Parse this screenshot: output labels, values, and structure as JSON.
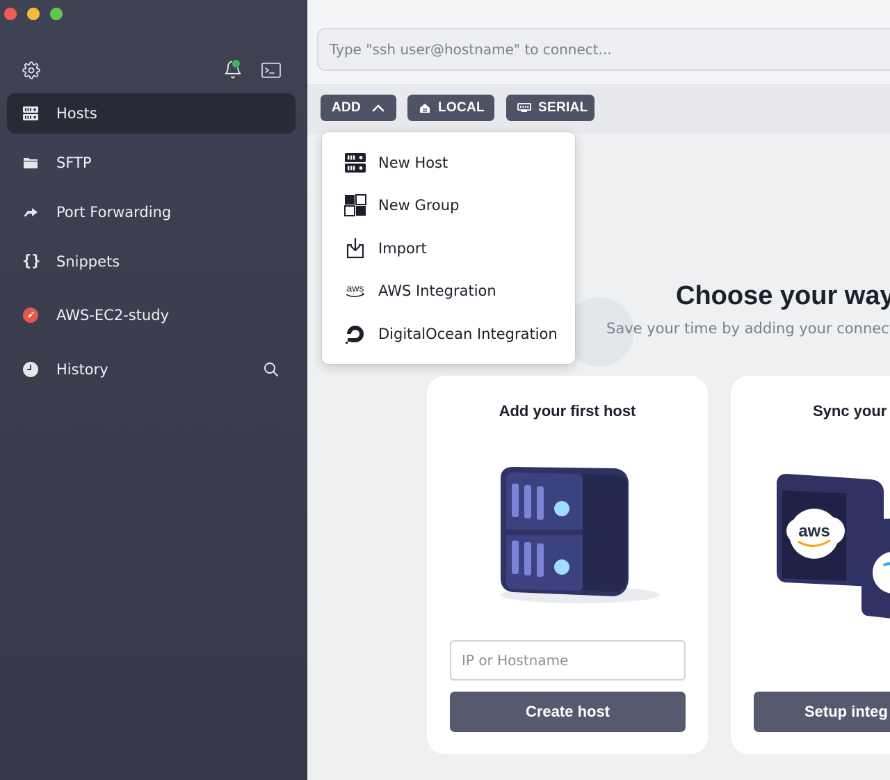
{
  "window": {
    "traffic_lights": [
      "close",
      "minimize",
      "zoom"
    ]
  },
  "sidebar": {
    "top_icons": [
      "gear-icon",
      "bell-icon",
      "terminal-icon"
    ],
    "notification_dot_color": "#3db35a",
    "items": [
      {
        "label": "Hosts",
        "icon": "server-icon",
        "active": true
      },
      {
        "label": "SFTP",
        "icon": "folder-icon",
        "active": false
      },
      {
        "label": "Port Forwarding",
        "icon": "forward-arrow-icon",
        "active": false
      },
      {
        "label": "Snippets",
        "icon": "braces-icon",
        "active": false
      },
      {
        "label": "AWS-EC2-study",
        "icon": "ec2-rocket-icon",
        "active": false
      },
      {
        "label": "History",
        "icon": "clock-icon",
        "active": false
      }
    ],
    "history_search_icon": "search-icon"
  },
  "quick_connect": {
    "placeholder": "Type \"ssh user@hostname\" to connect..."
  },
  "toolbar": {
    "add_label": "ADD",
    "local_label": "LOCAL",
    "serial_label": "SERIAL"
  },
  "add_menu": {
    "items": [
      {
        "label": "New Host",
        "icon": "server-icon"
      },
      {
        "label": "New Group",
        "icon": "group-icon"
      },
      {
        "label": "Import",
        "icon": "import-icon"
      },
      {
        "label": "AWS Integration",
        "icon": "aws-icon"
      },
      {
        "label": "DigitalOcean Integration",
        "icon": "digitalocean-icon"
      }
    ]
  },
  "main": {
    "title": "Choose your way",
    "subtitle": "Save your time by adding your connectio",
    "cards": [
      {
        "title": "Add your first host",
        "input_placeholder": "IP or Hostname",
        "button_label": "Create host"
      },
      {
        "title": "Sync your",
        "aws_logo_text": "aws",
        "button_label": "Setup integ"
      }
    ]
  },
  "colors": {
    "sidebar_bg": "#3f4252",
    "active_item_bg": "#282a36",
    "button_bg": "#4f5366",
    "accent_red": "#e25a4e"
  }
}
